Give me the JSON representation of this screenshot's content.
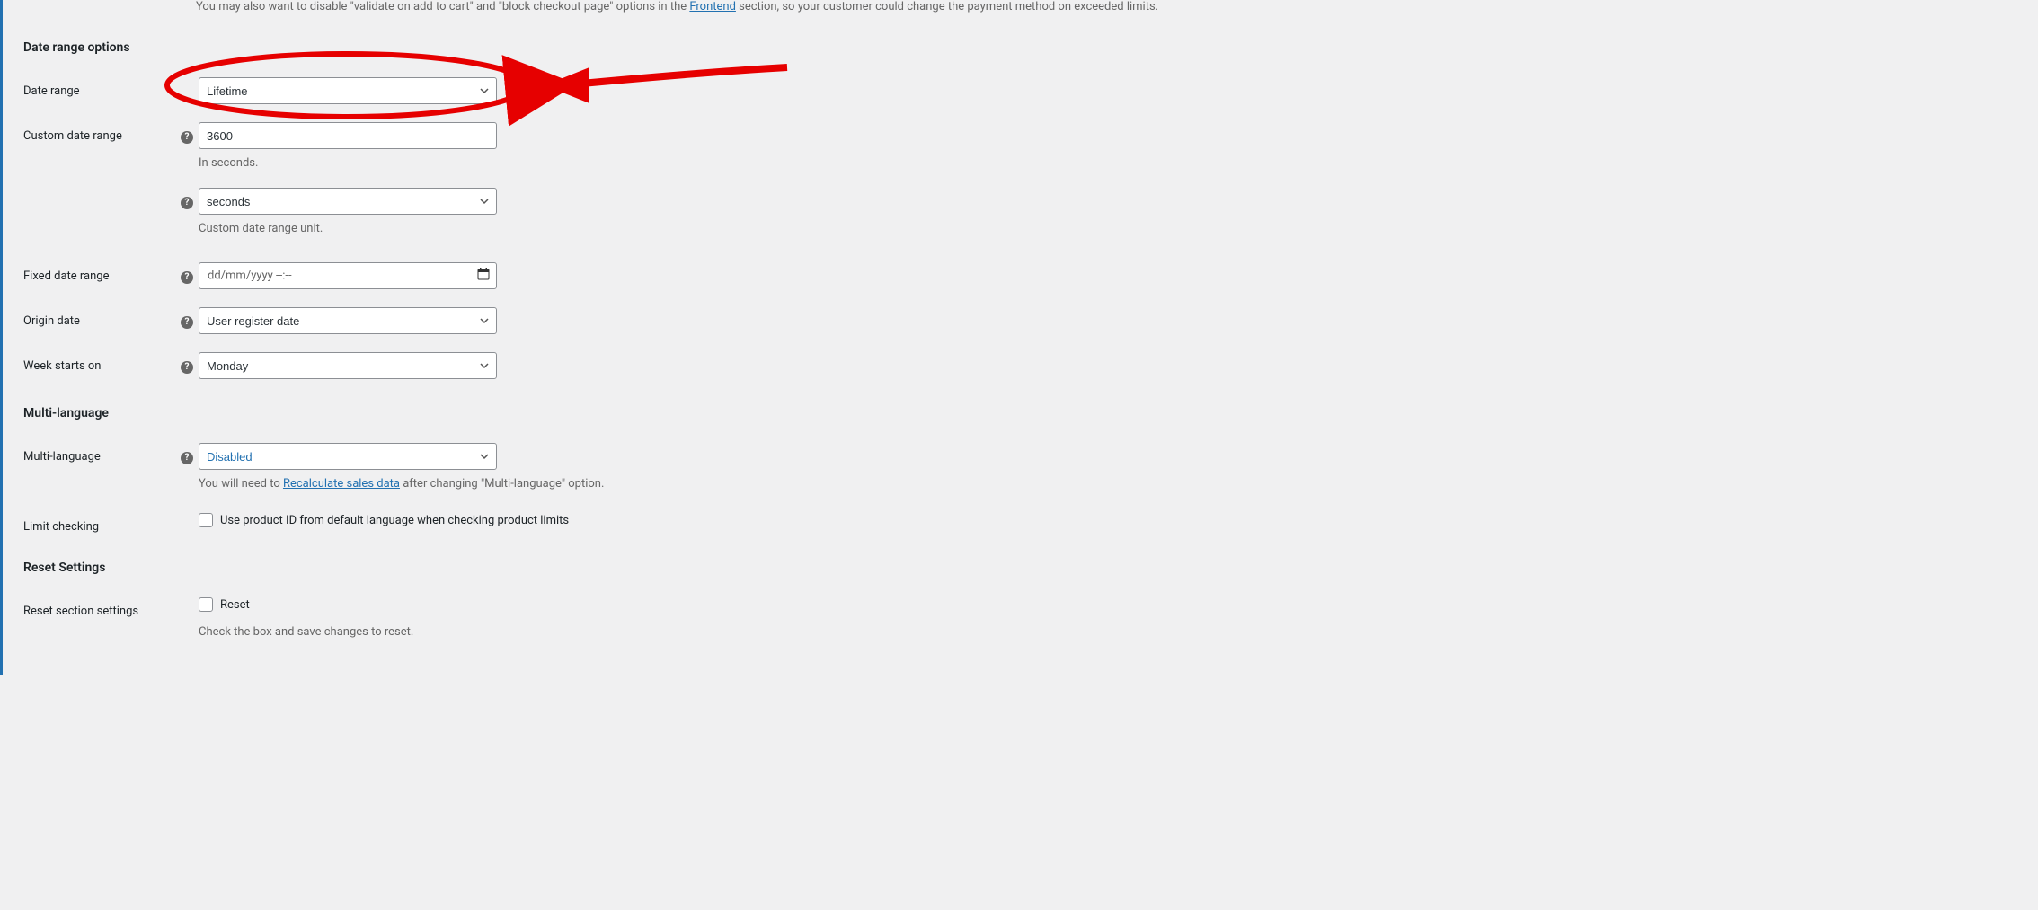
{
  "intro": {
    "prefix": "You may also want to disable \"validate on add to cart\" and \"block checkout page\" options in the ",
    "link": "Frontend",
    "suffix": " section, so your customer could change the payment method on exceeded limits."
  },
  "sections": {
    "date_range_options": {
      "title": "Date range options",
      "fields": {
        "date_range": {
          "label": "Date range",
          "value": "Lifetime"
        },
        "custom_date_range": {
          "label": "Custom date range",
          "value": "3600",
          "help": "In seconds."
        },
        "custom_date_range_unit": {
          "value": "seconds",
          "help": "Custom date range unit."
        },
        "fixed_date_range": {
          "label": "Fixed date range",
          "placeholder": "dd/mm/yyyy --:--"
        },
        "origin_date": {
          "label": "Origin date",
          "value": "User register date"
        },
        "week_starts_on": {
          "label": "Week starts on",
          "value": "Monday"
        }
      }
    },
    "multi_language": {
      "title": "Multi-language",
      "fields": {
        "multi_language": {
          "label": "Multi-language",
          "value": "Disabled",
          "help_prefix": "You will need to ",
          "help_link": "Recalculate sales data",
          "help_suffix": " after changing \"Multi-language\" option."
        },
        "limit_checking": {
          "label": "Limit checking",
          "checkbox_label": "Use product ID from default language when checking product limits"
        }
      }
    },
    "reset_settings": {
      "title": "Reset Settings",
      "fields": {
        "reset_section": {
          "label": "Reset section settings",
          "checkbox_label": "Reset",
          "help": "Check the box and save changes to reset."
        }
      }
    }
  }
}
